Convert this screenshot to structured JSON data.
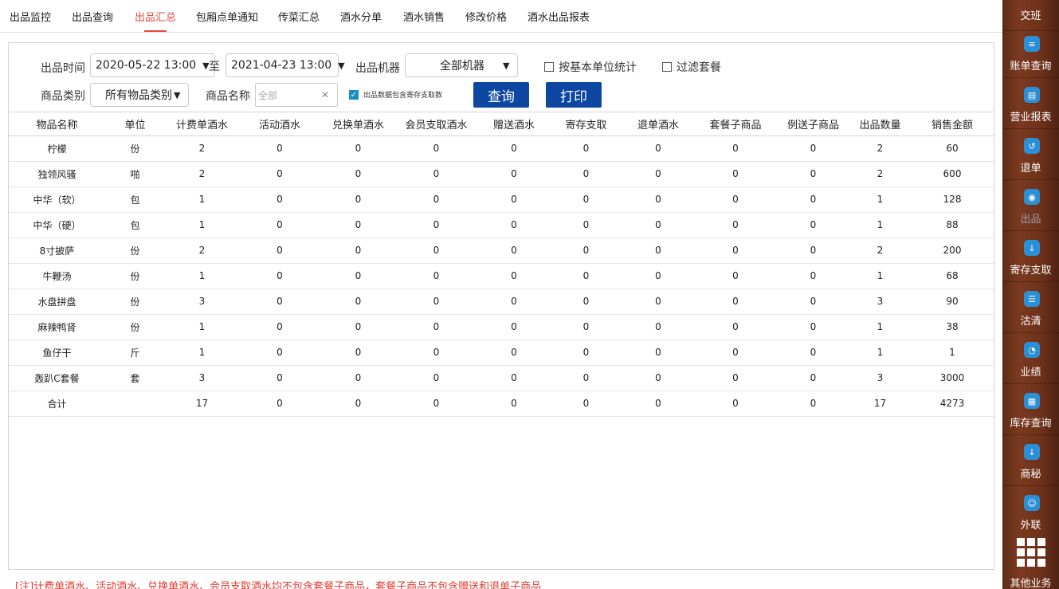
{
  "tabs": [
    "出品监控",
    "出品查询",
    "出品汇总",
    "包厢点单通知",
    "传菜汇总",
    "酒水分单",
    "酒水销售",
    "修改价格",
    "酒水出品报表"
  ],
  "active_tab": "出品汇总",
  "filters": {
    "time_label": "出品时间",
    "start_time": "2020-05-22 13:00",
    "to_label": "至",
    "end_time": "2021-04-23 13:00",
    "machine_label": "出品机器",
    "machine_value": "全部机器",
    "basic_unit_label": "按基本单位统计",
    "filter_combo_label": "过滤套餐",
    "category_label": "商品类别",
    "category_value": "所有物品类别",
    "name_label": "商品名称",
    "name_placeholder": "全部",
    "include_storage_label": "出品数据包含寄存支取数",
    "query_button": "查询",
    "print_button": "打印"
  },
  "table": {
    "headers": [
      "物品名称",
      "单位",
      "计费单酒水",
      "活动酒水",
      "兑换单酒水",
      "会员支取酒水",
      "赠送酒水",
      "寄存支取",
      "退单酒水",
      "套餐子商品",
      "例送子商品",
      "出品数量",
      "销售金额"
    ],
    "rows": [
      [
        "柠檬",
        "份",
        "2",
        "0",
        "0",
        "0",
        "0",
        "0",
        "0",
        "0",
        "0",
        "2",
        "60"
      ],
      [
        "独领风骚",
        "啪",
        "2",
        "0",
        "0",
        "0",
        "0",
        "0",
        "0",
        "0",
        "0",
        "2",
        "600"
      ],
      [
        "中华（软）",
        "包",
        "1",
        "0",
        "0",
        "0",
        "0",
        "0",
        "0",
        "0",
        "0",
        "1",
        "128"
      ],
      [
        "中华（硬）",
        "包",
        "1",
        "0",
        "0",
        "0",
        "0",
        "0",
        "0",
        "0",
        "0",
        "1",
        "88"
      ],
      [
        "8寸披萨",
        "份",
        "2",
        "0",
        "0",
        "0",
        "0",
        "0",
        "0",
        "0",
        "0",
        "2",
        "200"
      ],
      [
        "牛鞭汤",
        "份",
        "1",
        "0",
        "0",
        "0",
        "0",
        "0",
        "0",
        "0",
        "0",
        "1",
        "68"
      ],
      [
        "水盘拼盘",
        "份",
        "3",
        "0",
        "0",
        "0",
        "0",
        "0",
        "0",
        "0",
        "0",
        "3",
        "90"
      ],
      [
        "麻辣鸭肾",
        "份",
        "1",
        "0",
        "0",
        "0",
        "0",
        "0",
        "0",
        "0",
        "0",
        "1",
        "38"
      ],
      [
        "鱼仔干",
        "斤",
        "1",
        "0",
        "0",
        "0",
        "0",
        "0",
        "0",
        "0",
        "0",
        "1",
        "1"
      ],
      [
        "轰趴C套餐",
        "套",
        "3",
        "0",
        "0",
        "0",
        "0",
        "0",
        "0",
        "0",
        "0",
        "3",
        "3000"
      ],
      [
        "合计",
        "",
        "17",
        "0",
        "0",
        "0",
        "0",
        "0",
        "0",
        "0",
        "0",
        "17",
        "4273"
      ]
    ]
  },
  "note": "[注]计费单酒水、活动酒水、兑换单酒水、会员支取酒水均不包含套餐子商品，套餐子商品不包含赠送和退单子商品",
  "sidebar": {
    "items": [
      {
        "label": "交班",
        "icon": "handover-icon"
      },
      {
        "label": "账单查询",
        "icon": "bill-query-icon"
      },
      {
        "label": "营业报表",
        "icon": "report-icon"
      },
      {
        "label": "退单",
        "icon": "refund-icon"
      },
      {
        "label": "出品",
        "icon": "output-icon"
      },
      {
        "label": "寄存支取",
        "icon": "storage-icon"
      },
      {
        "label": "沽清",
        "icon": "soldout-icon"
      },
      {
        "label": "业绩",
        "icon": "performance-icon"
      },
      {
        "label": "库存查询",
        "icon": "inventory-icon"
      },
      {
        "label": "商秘",
        "icon": "secretary-icon"
      },
      {
        "label": "外联",
        "icon": "external-icon"
      }
    ],
    "other_label": "其他业务",
    "active_item": "出品"
  },
  "colors": {
    "accent_tab": "#e8493b",
    "button": "#0d47a1",
    "note": "#e03a2f",
    "sidebar": "#6c3019",
    "icon": "#2b8fd6"
  }
}
